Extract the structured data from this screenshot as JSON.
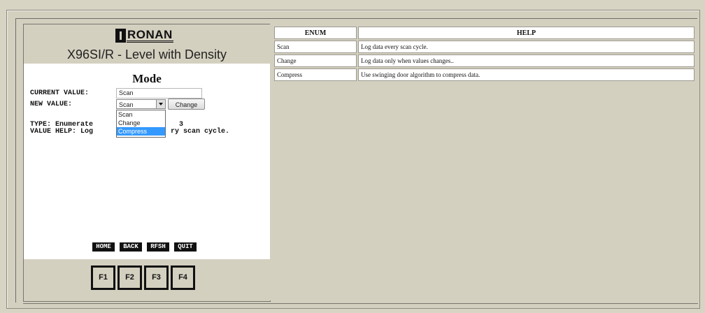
{
  "device": {
    "logo_text": "RONAN",
    "title": "X96SI/R - Level with Density"
  },
  "screen": {
    "heading": "Mode",
    "current_value_label": "CURRENT VALUE:",
    "current_value": "Scan",
    "new_value_label": "NEW VALUE:",
    "selected_value": "Scan",
    "change_button": "Change",
    "dropdown_options": [
      "Scan",
      "Change",
      "Compress"
    ],
    "highlighted_option": "Compress",
    "type_line": "TYPE: Enumerate",
    "type_tail": "3",
    "value_help_line": "VALUE HELP: Log",
    "value_help_tail": "ry scan cycle."
  },
  "nav": {
    "home": "HOME",
    "back": "BACK",
    "rfsh": "RFSH",
    "quit": "QUIT"
  },
  "fkeys": [
    "F1",
    "F2",
    "F3",
    "F4"
  ],
  "enum_table": {
    "headers": [
      "ENUM",
      "HELP"
    ],
    "rows": [
      {
        "enum": "Scan",
        "help": "Log data every scan cycle."
      },
      {
        "enum": "Change",
        "help": "Log data only when values changes.."
      },
      {
        "enum": "Compress",
        "help": "Use swinging door algorithm to compress data."
      }
    ]
  },
  "colors": {
    "panel_bg": "#d4d0c0",
    "screen_bg": "#ffffff",
    "highlight": "#3399ff"
  }
}
